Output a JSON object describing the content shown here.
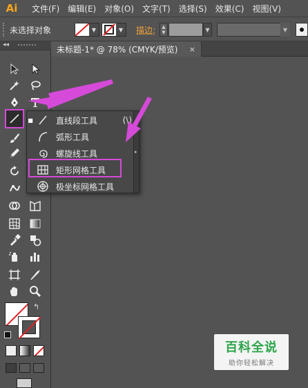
{
  "app": {
    "logo": "Ai"
  },
  "menubar": {
    "items": [
      "文件(F)",
      "编辑(E)",
      "对象(O)",
      "文字(T)",
      "选择(S)",
      "效果(C)",
      "视图(V)"
    ]
  },
  "control_bar": {
    "selection_label": "未选择对象",
    "stroke_label": "描边:",
    "stroke_weight": ""
  },
  "document": {
    "tab_title": "未标题-1* @ 78% (CMYK/预览)",
    "close_glyph": "×"
  },
  "toolbar": {
    "collapse_glyph": "◂◂",
    "tools": [
      "selection-tool",
      "direct-selection-tool",
      "magic-wand-tool",
      "lasso-tool",
      "pen-tool",
      "type-tool",
      "line-segment-tool",
      "paintbrush-tool",
      "pencil-tool",
      "rotate-tool",
      "warp-tool",
      "shape-builder-tool",
      "symbol-sprayer-tool",
      "mesh-tool",
      "gradient-tool",
      "eyedropper-tool",
      "blend-tool",
      "column-graph-tool",
      "artboard-tool",
      "slice-tool",
      "hand-tool",
      "zoom-tool"
    ],
    "fill_color": "#ffffff",
    "stroke_color": "#000000"
  },
  "flyout": {
    "items": [
      {
        "label": "直线段工具",
        "shortcut": "(\\)",
        "icon": "line-icon",
        "current": true
      },
      {
        "label": "弧形工具",
        "shortcut": "",
        "icon": "arc-icon",
        "current": false
      },
      {
        "label": "螺旋线工具",
        "shortcut": "",
        "icon": "spiral-icon",
        "current": false
      },
      {
        "label": "矩形网格工具",
        "shortcut": "",
        "icon": "rect-grid-icon",
        "current": false
      },
      {
        "label": "极坐标网格工具",
        "shortcut": "",
        "icon": "polar-grid-icon",
        "current": false
      }
    ],
    "current_bullet": "■",
    "tearoff_glyph": "▸"
  },
  "annotations": {
    "highlight_color": "#d54ad8"
  },
  "watermark": {
    "title": "百科全说",
    "subtitle": "助你轻松解决"
  }
}
